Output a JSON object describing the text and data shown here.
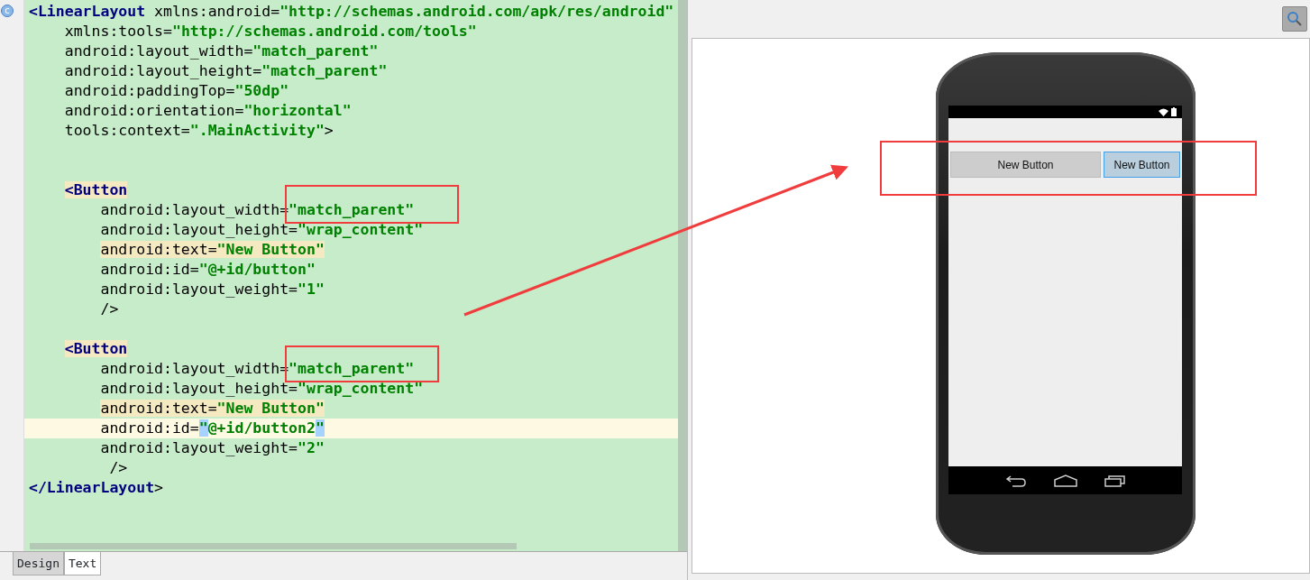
{
  "editor": {
    "gutter_badge": "c",
    "lines": [
      {
        "kind": "code",
        "tokens": [
          {
            "kind": "tag",
            "text": "<LinearLayout"
          },
          {
            "kind": "attr",
            "text": " xmlns:android="
          },
          {
            "kind": "value",
            "text": "\"http://schemas.android.com/apk/res/android\""
          }
        ],
        "children": [
          {
            "kind": "code",
            "tokens": [
              {
                "kind": "attr",
                "text": "xmlns:tools="
              },
              {
                "kind": "value",
                "text": "\"http://schemas.android.com/tools\""
              }
            ]
          },
          {
            "kind": "code",
            "tokens": [
              {
                "kind": "attr",
                "text": "android:layout_width="
              },
              {
                "kind": "value",
                "text": "\"match_parent\""
              }
            ]
          },
          {
            "kind": "code",
            "tokens": [
              {
                "kind": "attr",
                "text": "android:layout_height="
              },
              {
                "kind": "value",
                "text": "\"match_parent\""
              }
            ]
          },
          {
            "kind": "code",
            "tokens": [
              {
                "kind": "attr",
                "text": "android:paddingTop="
              },
              {
                "kind": "value",
                "text": "\"50dp\""
              }
            ]
          },
          {
            "kind": "code",
            "tokens": [
              {
                "kind": "attr",
                "text": "android:orientation="
              },
              {
                "kind": "value",
                "text": "\"horizontal\""
              }
            ]
          },
          {
            "kind": "code",
            "tokens": [
              {
                "kind": "attr",
                "text": "tools:context="
              },
              {
                "kind": "value",
                "text": "\".MainActivity\""
              },
              {
                "kind": "attr",
                "text": ">"
              }
            ]
          },
          {
            "kind": "blank"
          },
          {
            "kind": "blank"
          },
          {
            "kind": "code",
            "tokens": [
              {
                "kind": "tag",
                "text": "<Button",
                "highlighted": true
              }
            ],
            "children": [
              {
                "kind": "code",
                "tokens": [
                  {
                    "kind": "attr",
                    "text": "android:layout_width="
                  },
                  {
                    "kind": "value",
                    "text": "\"match_parent\""
                  }
                ]
              },
              {
                "kind": "code",
                "tokens": [
                  {
                    "kind": "attr",
                    "text": "android:layout_height="
                  },
                  {
                    "kind": "value",
                    "text": "\"wrap_content\""
                  }
                ]
              },
              {
                "kind": "code",
                "tokens": [
                  {
                    "kind": "attr",
                    "text": "android:text=",
                    "highlighted": true
                  },
                  {
                    "kind": "value",
                    "text": "\"New Button\"",
                    "highlighted": true
                  }
                ]
              },
              {
                "kind": "code",
                "tokens": [
                  {
                    "kind": "attr",
                    "text": "android:id="
                  },
                  {
                    "kind": "value",
                    "text": "\"@+id/button\""
                  }
                ]
              },
              {
                "kind": "code",
                "tokens": [
                  {
                    "kind": "attr",
                    "text": "android:layout_weight="
                  },
                  {
                    "kind": "value",
                    "text": "\"1\""
                  }
                ]
              },
              {
                "kind": "code",
                "tokens": [
                  {
                    "kind": "attr",
                    "text": "/>"
                  }
                ]
              }
            ]
          },
          {
            "kind": "blank"
          },
          {
            "kind": "code",
            "tokens": [
              {
                "kind": "tag",
                "text": "<Button",
                "highlighted": true
              }
            ],
            "children": [
              {
                "kind": "code",
                "tokens": [
                  {
                    "kind": "attr",
                    "text": "android:layout_width="
                  },
                  {
                    "kind": "value",
                    "text": "\"match_parent\""
                  }
                ]
              },
              {
                "kind": "code",
                "tokens": [
                  {
                    "kind": "attr",
                    "text": "android:layout_height="
                  },
                  {
                    "kind": "value",
                    "text": "\"wrap_content\""
                  }
                ]
              },
              {
                "kind": "code",
                "tokens": [
                  {
                    "kind": "attr",
                    "text": "android:text=",
                    "highlighted": true
                  },
                  {
                    "kind": "value",
                    "text": "\"New Button\"",
                    "highlighted": true
                  }
                ]
              },
              {
                "kind": "code",
                "current": true,
                "tokens": [
                  {
                    "kind": "attr",
                    "text": "android:id="
                  },
                  {
                    "kind": "value",
                    "text": "\"",
                    "selected": true
                  },
                  {
                    "kind": "value",
                    "text": "@+id/button2"
                  },
                  {
                    "kind": "value",
                    "text": "\"",
                    "selected": true
                  }
                ]
              },
              {
                "kind": "code",
                "tokens": [
                  {
                    "kind": "attr",
                    "text": "android:layout_weight="
                  },
                  {
                    "kind": "value",
                    "text": "\"2\""
                  }
                ]
              },
              {
                "kind": "code",
                "tokens": [
                  {
                    "kind": "attr",
                    "text": " />"
                  }
                ]
              }
            ]
          }
        ]
      },
      {
        "kind": "code",
        "tokens": [
          {
            "kind": "tag",
            "text": "</LinearLayout"
          },
          {
            "kind": "attr",
            "text": ">"
          }
        ]
      }
    ]
  },
  "tabs": [
    {
      "label": "Design",
      "selected": false
    },
    {
      "label": "Text",
      "selected": true
    }
  ],
  "preview": {
    "buttons": [
      {
        "label": "New Button",
        "selected": false
      },
      {
        "label": "New Button",
        "selected": true
      }
    ]
  }
}
